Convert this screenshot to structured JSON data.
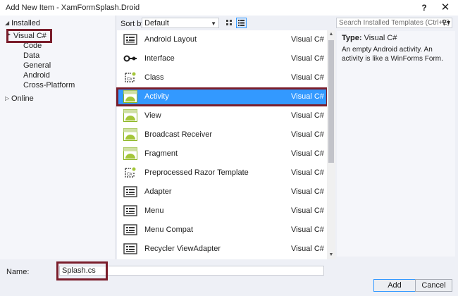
{
  "window": {
    "title": "Add New Item - XamFormSplash.Droid",
    "help": "?",
    "close": "✕"
  },
  "tree": {
    "installed": "Installed",
    "visual_csharp": "Visual C#",
    "children": [
      "Code",
      "Data",
      "General",
      "Android",
      "Cross-Platform"
    ],
    "online": "Online"
  },
  "sortbar": {
    "label": "Sort by:",
    "value": "Default"
  },
  "search": {
    "placeholder": "Search Installed Templates (Ctrl+E)"
  },
  "templates": [
    {
      "name": "Android Layout",
      "lang": "Visual C#",
      "icon": "layout-icon"
    },
    {
      "name": "Interface",
      "lang": "Visual C#",
      "icon": "interface-icon"
    },
    {
      "name": "Class",
      "lang": "Visual C#",
      "icon": "class-icon"
    },
    {
      "name": "Activity",
      "lang": "Visual C#",
      "icon": "android-icon",
      "selected": true
    },
    {
      "name": "View",
      "lang": "Visual C#",
      "icon": "android-icon"
    },
    {
      "name": "Broadcast Receiver",
      "lang": "Visual C#",
      "icon": "android-icon"
    },
    {
      "name": "Fragment",
      "lang": "Visual C#",
      "icon": "android-icon"
    },
    {
      "name": "Preprocessed Razor Template",
      "lang": "Visual C#",
      "icon": "class-icon"
    },
    {
      "name": "Adapter",
      "lang": "Visual C#",
      "icon": "layout-icon"
    },
    {
      "name": "Menu",
      "lang": "Visual C#",
      "icon": "layout-icon"
    },
    {
      "name": "Menu Compat",
      "lang": "Visual C#",
      "icon": "layout-icon"
    },
    {
      "name": "Recycler ViewAdapter",
      "lang": "Visual C#",
      "icon": "layout-icon"
    }
  ],
  "details": {
    "type_label": "Type:",
    "type_value": "Visual C#",
    "description": "An empty Android activity.  An activity is like a WinForms Form."
  },
  "bottom": {
    "name_label": "Name:",
    "name_value": "Splash.cs",
    "add": "Add",
    "cancel": "Cancel"
  },
  "colors": {
    "selection": "#3399ff",
    "highlight_box": "#7a1d2b",
    "android_green": "#a4c639"
  }
}
